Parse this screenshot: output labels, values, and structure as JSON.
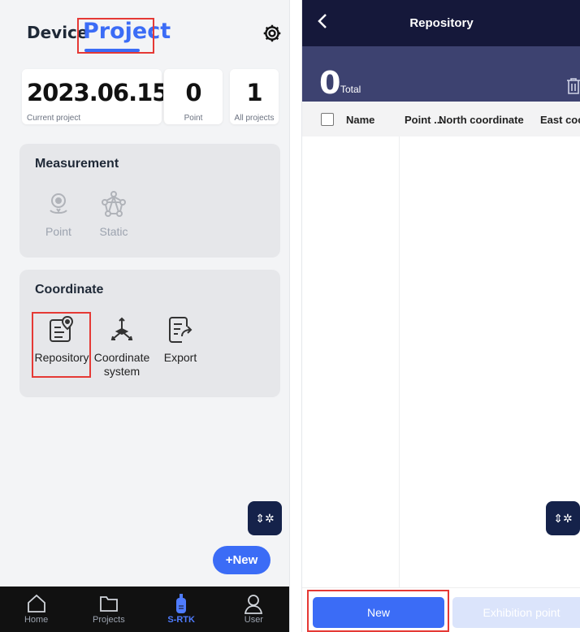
{
  "project_screen": {
    "tabs": {
      "device": "Device",
      "project": "Project"
    },
    "stats": {
      "current_project": {
        "value": "2023.06.15",
        "label": "Current project"
      },
      "point": {
        "value": "0",
        "label": "Point"
      },
      "all_projects": {
        "value": "1",
        "label": "All projects"
      }
    },
    "measurement": {
      "title": "Measurement",
      "items": [
        {
          "label": "Point"
        },
        {
          "label": "Static"
        }
      ]
    },
    "coordinate": {
      "title": "Coordinate",
      "items": [
        {
          "label": "Repository"
        },
        {
          "label": "Coordinate\nsystem"
        },
        {
          "label": "Export"
        }
      ]
    },
    "bluetooth_glyph": "⇕✲",
    "new_button": "+New",
    "bottom_nav": [
      {
        "label": "Home",
        "icon": "home-icon"
      },
      {
        "label": "Projects",
        "icon": "folder-icon"
      },
      {
        "label": "S-RTK",
        "icon": "receiver-icon"
      },
      {
        "label": "User",
        "icon": "user-icon"
      }
    ]
  },
  "repository_screen": {
    "title": "Repository",
    "count": "0",
    "count_label": "Total",
    "columns": [
      "Name",
      "Point ...",
      "North coordinate",
      "East coo"
    ],
    "rows": [],
    "bluetooth_glyph": "⇕✲",
    "footer": {
      "new": "New",
      "exhibition": "Exhibition point"
    }
  },
  "colors": {
    "accent": "#3b6cf6",
    "header_dark": "#15183a",
    "summary_bar": "#3d4270",
    "highlight": "#e53935"
  }
}
